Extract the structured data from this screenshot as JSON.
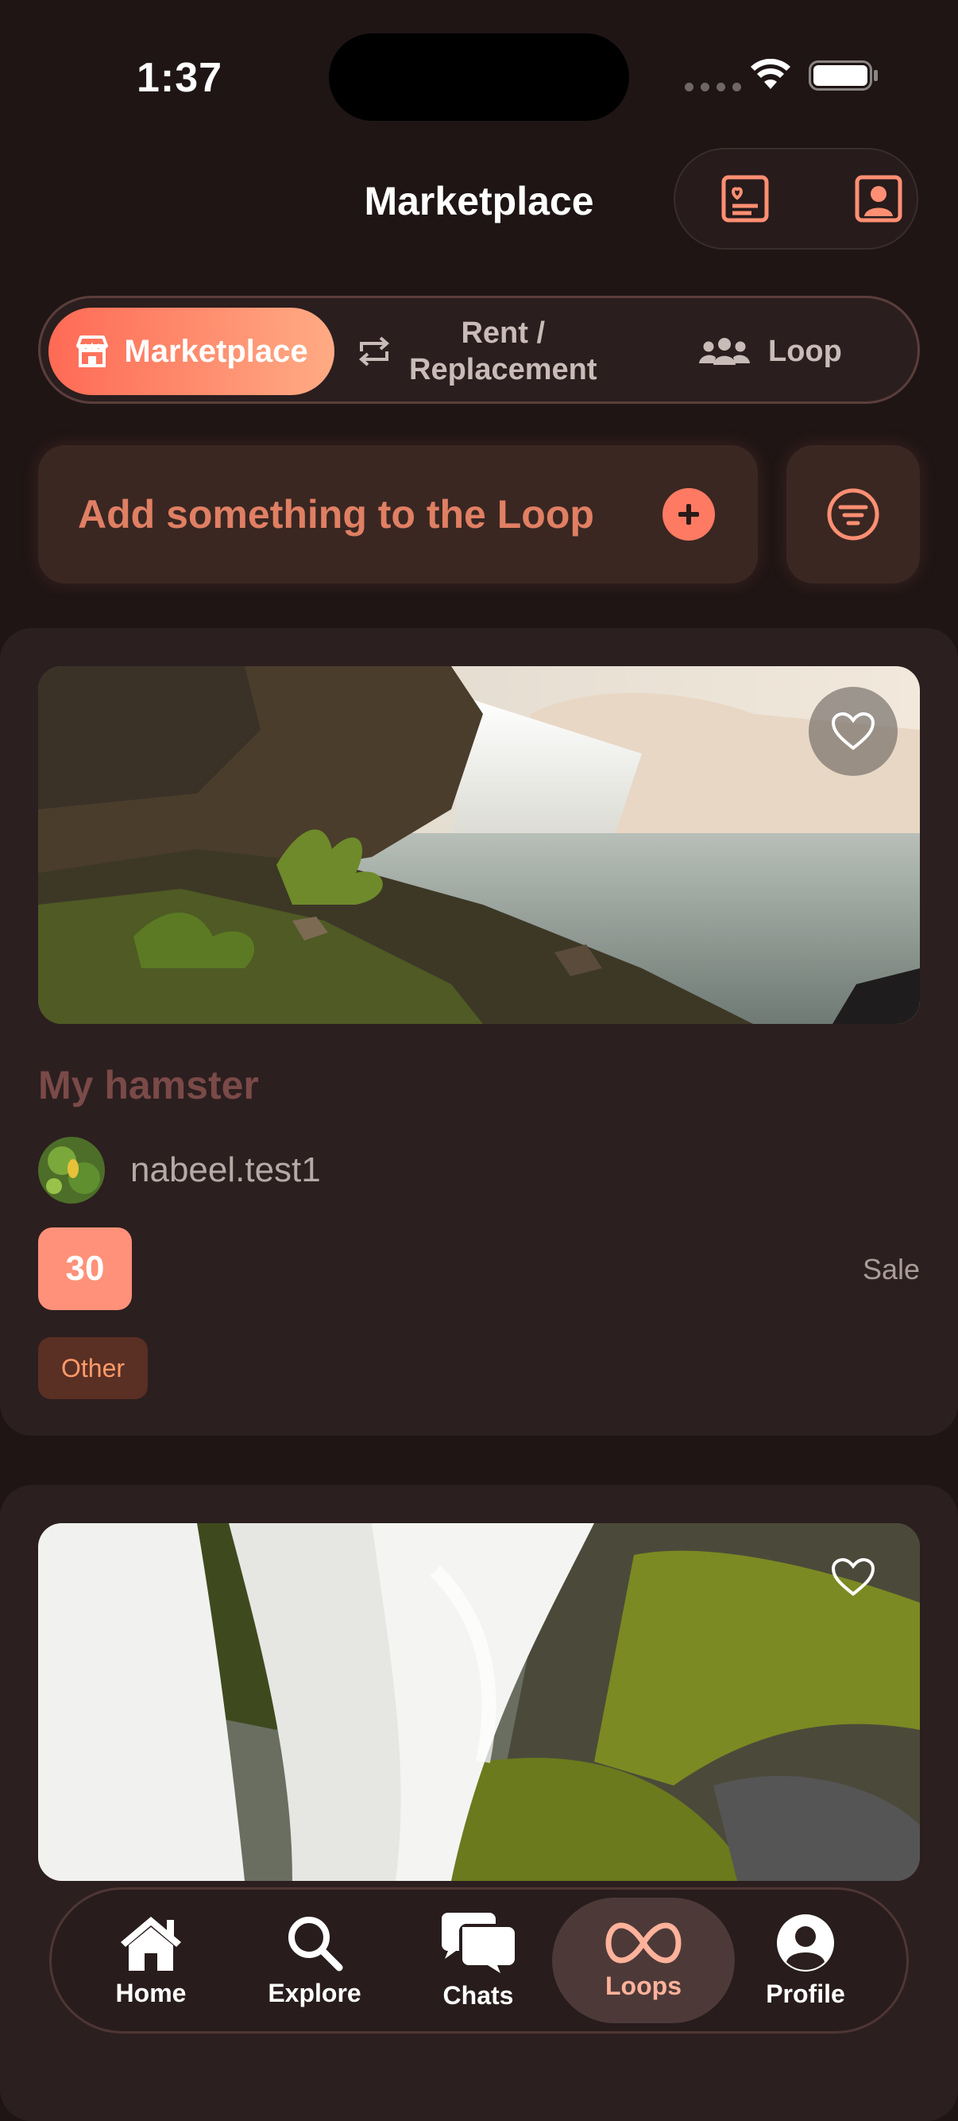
{
  "status_bar": {
    "time": "1:37"
  },
  "header": {
    "title": "Marketplace"
  },
  "segments": {
    "active": "Marketplace",
    "rent": "Rent /\nReplacement",
    "loop": "Loop"
  },
  "add_bar": {
    "placeholder": "Add something to the Loop"
  },
  "listings": [
    {
      "title": "My hamster",
      "seller": "nabeel.test1",
      "price": "30",
      "type": "Sale",
      "category": "Other"
    }
  ],
  "tabbar": {
    "home": "Home",
    "explore": "Explore",
    "chats": "Chats",
    "loops": "Loops",
    "profile": "Profile",
    "active": "Loops"
  },
  "colors": {
    "background": "#1f1515",
    "card": "#2c1f1f",
    "accent": "#ff7a62",
    "accent_light": "#ffab84",
    "title_muted": "#7a4a48"
  }
}
